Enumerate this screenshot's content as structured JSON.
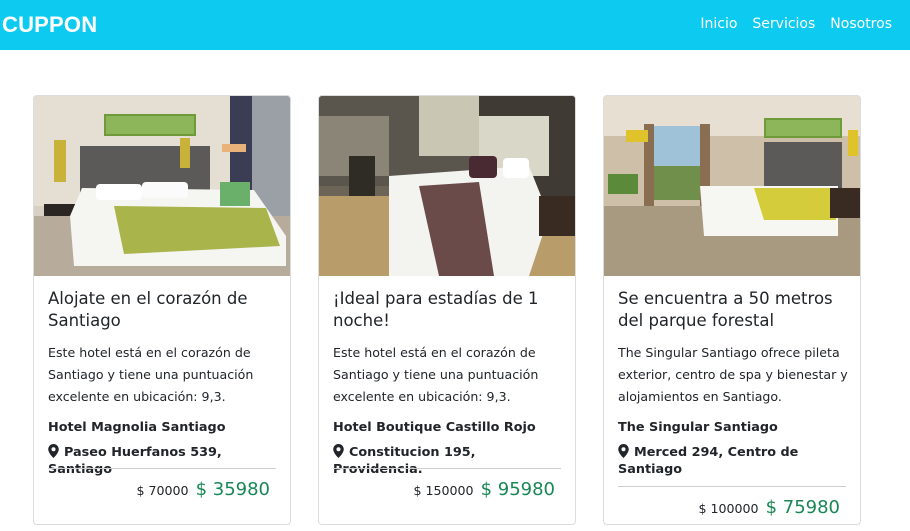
{
  "navbar": {
    "brand": "CUPPON",
    "links": [
      "Inicio",
      "Servicios",
      "Nosotros"
    ]
  },
  "cards": [
    {
      "title": "Alojate en el corazón de Santiago",
      "text": "Este hotel está en el corazón de Santiago y tiene una puntuación excelente en ubicación: 9,3.",
      "hotel": "Hotel Magnolia Santiago",
      "address": "Paseo Huerfanos 539, Santiago",
      "old_price": "$ 70000",
      "new_price": "$ 35980",
      "icon": "map-marker-icon"
    },
    {
      "title": "¡Ideal para estadías de 1 noche!",
      "text": "Este hotel está en el corazón de Santiago y tiene una puntuación excelente en ubicación: 9,3.",
      "hotel": "Hotel Boutique Castillo Rojo",
      "address": "Constitucion 195, Providencia.",
      "old_price": "$ 150000",
      "new_price": "$ 95980",
      "icon": "map-marker-icon"
    },
    {
      "title": "Se encuentra a 50 metros del parque forestal",
      "text": "The Singular Santiago ofrece pileta exterior, centro de spa y bienestar y alojamientos en Santiago.",
      "hotel": "The Singular Santiago",
      "address": "Merced 294, Centro de Santiago",
      "old_price": "$ 100000",
      "new_price": "$ 75980",
      "icon": "map-marker-icon"
    }
  ],
  "colors": {
    "navbar": "#0dcaf0",
    "price_green": "#198754"
  }
}
